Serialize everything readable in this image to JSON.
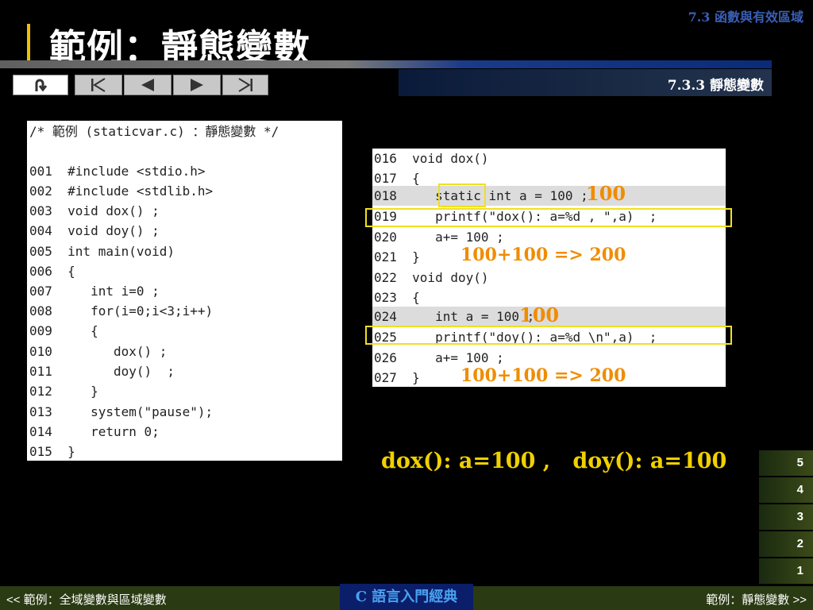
{
  "header": {
    "section": "7.3 函數與有效區域",
    "title": "範例：靜態變數",
    "subtitle": "7.3.3 靜態變數"
  },
  "nav": {
    "return_icon": "return-icon",
    "first_icon": "skip-first-icon",
    "prev_icon": "prev-icon",
    "next_icon": "next-icon",
    "last_icon": "skip-last-icon"
  },
  "left_code": [
    "/* 範例 (staticvar.c) ：靜態變數 */",
    "",
    "001  #include <stdio.h>",
    "002  #include <stdlib.h>",
    "003  void dox() ;",
    "004  void doy() ;",
    "005  int main(void)",
    "006  {",
    "007     int i=0 ;",
    "008     for(i=0;i<3;i++)",
    "009     {",
    "010        dox() ;",
    "011        doy()  ;",
    "012     }",
    "013     system(\"pause\");",
    "014     return 0;",
    "015  }"
  ],
  "right_code": [
    "016  void dox()",
    "017  {",
    "018     static int a = 100 ;",
    "019     printf(\"dox(): a=%d , \",a)  ;",
    "020     a+= 100 ;",
    "021  }",
    "022  void doy()",
    "023  {",
    "024     int a = 100 ;",
    "025     printf(\"doy(): a=%d \\n\",a)  ;",
    "026     a+= 100 ;",
    "027  }"
  ],
  "annotations": {
    "dox_value": "100",
    "dox_result": "100+100 => 200",
    "doy_value": "100",
    "doy_result": "100+100 => 200"
  },
  "output": "dox(): a=100 ,   doy(): a=100",
  "pages": [
    "5",
    "4",
    "3",
    "2",
    "1"
  ],
  "footer": {
    "prev_link": "<< 範例：全域變數與區域變數",
    "center": "C 語言入門經典",
    "next_link": "範例：靜態變數 >>"
  }
}
